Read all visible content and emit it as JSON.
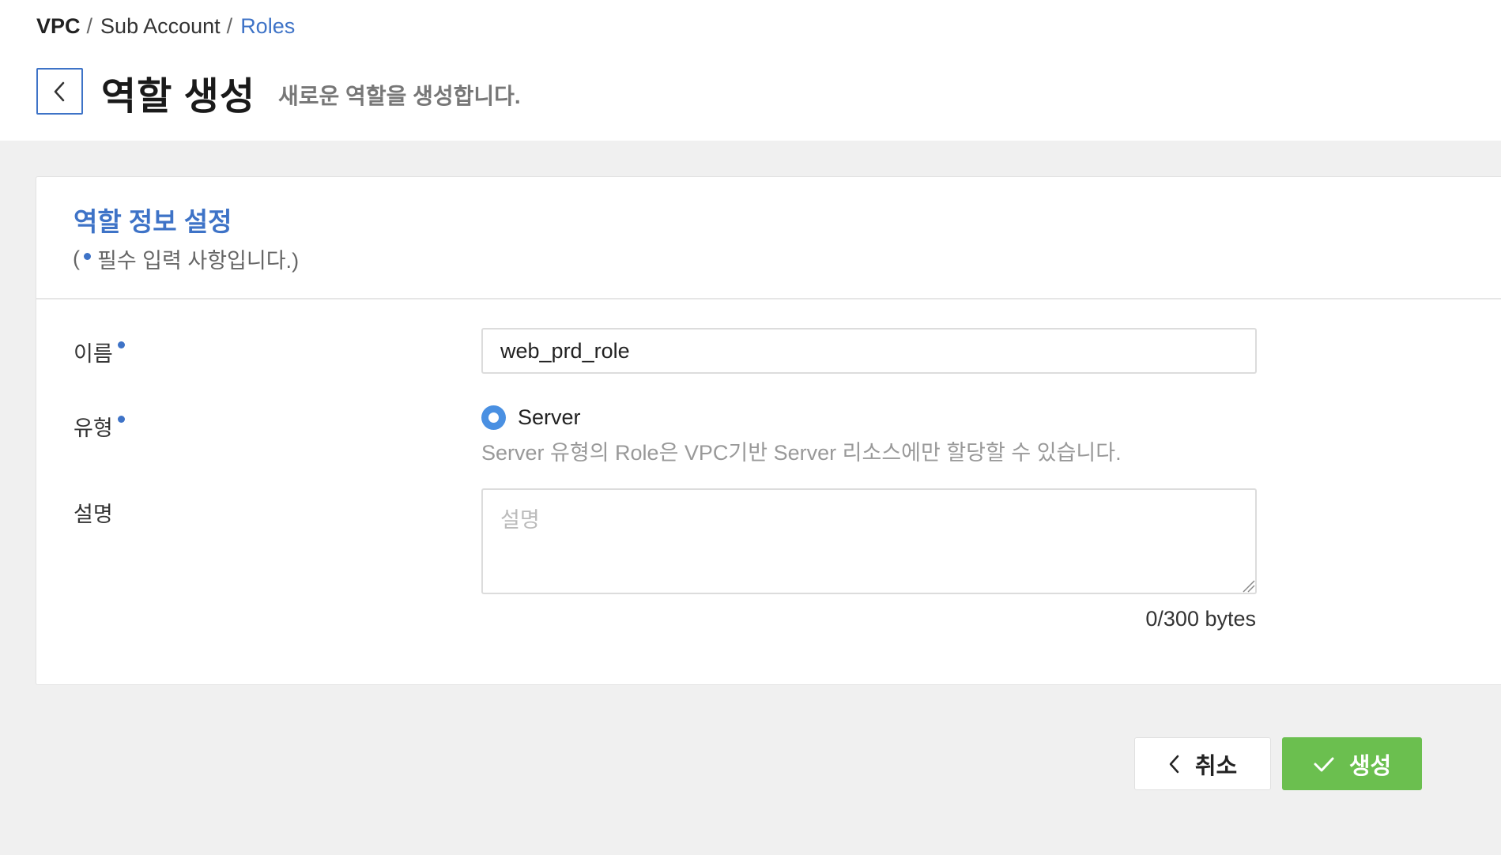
{
  "breadcrumb": {
    "items": [
      "VPC",
      "Sub Account",
      "Roles"
    ],
    "separator": "/"
  },
  "header": {
    "title": "역할 생성",
    "description": "새로운 역할을 생성합니다.",
    "back_icon": "chevron-left-icon"
  },
  "section": {
    "title": "역할 정보 설정",
    "required_note_open": "(",
    "required_note_text": "필수 입력 사항입니다.)"
  },
  "form": {
    "name": {
      "label": "이름",
      "value": "web_prd_role"
    },
    "type": {
      "label": "유형",
      "option_label": "Server",
      "help": "Server 유형의 Role은 VPC기반 Server 리소스에만 할당할 수 있습니다."
    },
    "description": {
      "label": "설명",
      "placeholder": "설명",
      "value": "",
      "counter": "0/300 bytes"
    }
  },
  "actions": {
    "cancel_label": "취소",
    "create_label": "생성"
  },
  "colors": {
    "accent": "#3e73c7",
    "radio": "#4a90e2",
    "create_button": "#6bbf4f"
  }
}
